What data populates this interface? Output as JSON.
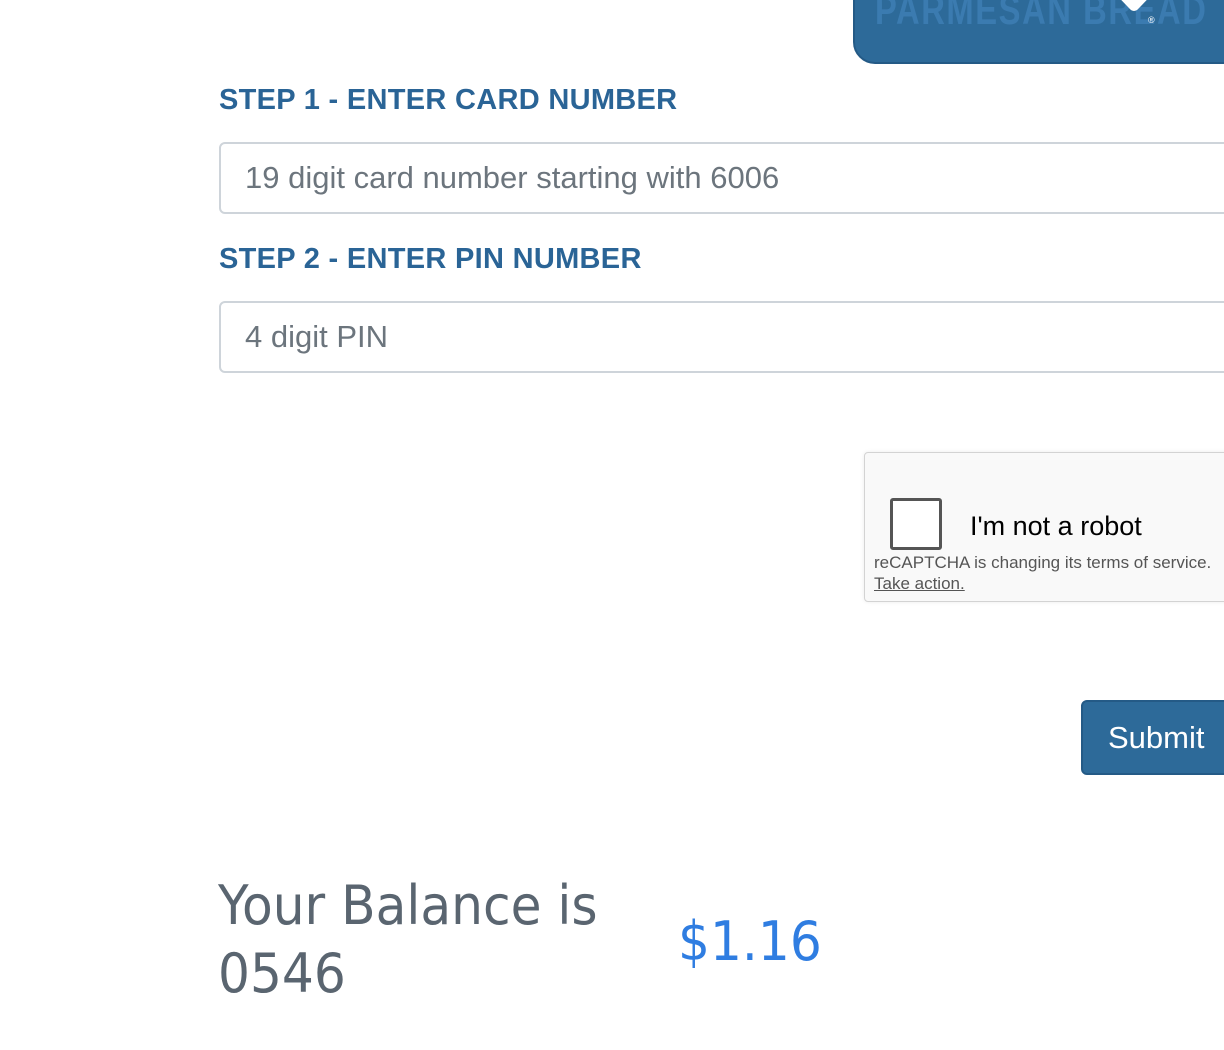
{
  "brand": {
    "banner_text": "PARMESAN BREAD",
    "registered_mark": "®",
    "logo": "chevron-logo-icon",
    "color": "#2d6a99"
  },
  "form": {
    "step1": {
      "label": "STEP 1 - ENTER CARD NUMBER",
      "value": "",
      "placeholder": "19 digit card number starting with 6006"
    },
    "step2": {
      "label": "STEP 2 - ENTER PIN NUMBER",
      "value": "",
      "placeholder": "4 digit PIN"
    },
    "submit_label": "Submit"
  },
  "recaptcha": {
    "checkbox_label": "I'm not a robot",
    "checked": false,
    "notice": "reCAPTCHA is changing its terms of service.",
    "link_text": "Take action."
  },
  "balance": {
    "label": "Your Balance is 0546",
    "amount": "$1.16"
  },
  "colors": {
    "accent": "#2a6496",
    "button": "#2d6a99",
    "balance_amount": "#2f7de1",
    "balance_text": "#5a6570"
  }
}
